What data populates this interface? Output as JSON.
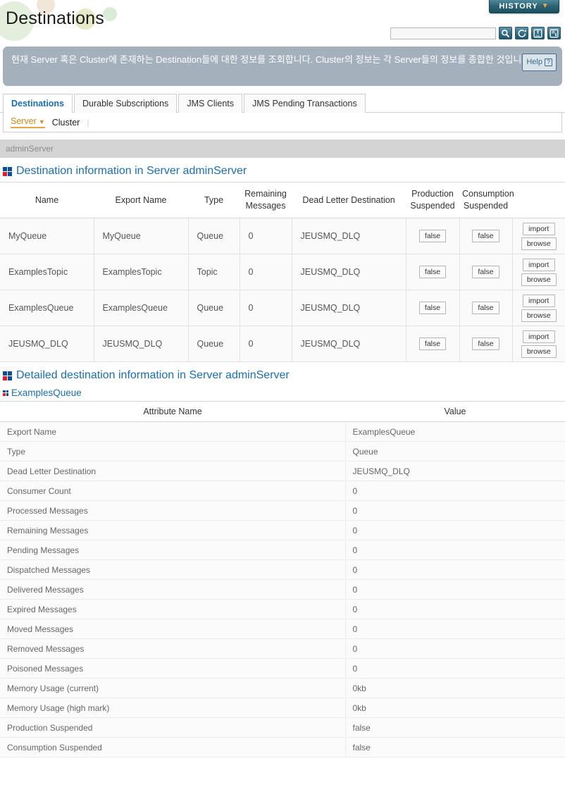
{
  "header": {
    "title": "Destinations",
    "history_label": "HISTORY",
    "history_caret": "▼",
    "search_value": "",
    "search_placeholder": "",
    "icons": [
      "search-icon",
      "refresh-icon",
      "xml-export-icon",
      "save-report-icon"
    ]
  },
  "description": {
    "text": "현재 Server 혹은 Cluster에 존재하는 Destination들에 대한 정보를 조회합니다. Cluster의 정보는 각 Server들의 정보를 종합한 것입니다.",
    "help_label": "Help",
    "help_mark": "?"
  },
  "tabs": [
    {
      "label": "Destinations",
      "active": true
    },
    {
      "label": "Durable Subscriptions",
      "active": false
    },
    {
      "label": "JMS Clients",
      "active": false
    },
    {
      "label": "JMS Pending Transactions",
      "active": false
    }
  ],
  "subtabs": {
    "server": "Server",
    "server_caret": "▼",
    "cluster": "Cluster",
    "separator": "|"
  },
  "server_bar": {
    "name": "adminServer"
  },
  "destination_section": {
    "title": "Destination information in Server adminServer",
    "columns": [
      "Name",
      "Export Name",
      "Type",
      "Remaining\nMessages",
      "Dead Letter Destination",
      "Production\nSuspended",
      "Consumption\nSuspended",
      ""
    ],
    "columns_display": {
      "name": "Name",
      "export_name": "Export Name",
      "type": "Type",
      "remaining_messages_l1": "Remaining",
      "remaining_messages_l2": "Messages",
      "dead_letter": "Dead Letter Destination",
      "production_l1": "Production",
      "production_l2": "Suspended",
      "consumption_l1": "Consumption",
      "consumption_l2": "Suspended"
    },
    "rows": [
      {
        "name": "MyQueue",
        "export_name": "MyQueue",
        "type": "Queue",
        "remaining_messages": "0",
        "dead_letter": "JEUSMQ_DLQ",
        "production_suspended": "false",
        "consumption_suspended": "false",
        "import_label": "import",
        "browse_label": "browse"
      },
      {
        "name": "ExamplesTopic",
        "export_name": "ExamplesTopic",
        "type": "Topic",
        "remaining_messages": "0",
        "dead_letter": "JEUSMQ_DLQ",
        "production_suspended": "false",
        "consumption_suspended": "false",
        "import_label": "import",
        "browse_label": "browse"
      },
      {
        "name": "ExamplesQueue",
        "export_name": "ExamplesQueue",
        "type": "Queue",
        "remaining_messages": "0",
        "dead_letter": "JEUSMQ_DLQ",
        "production_suspended": "false",
        "consumption_suspended": "false",
        "import_label": "import",
        "browse_label": "browse"
      },
      {
        "name": "JEUSMQ_DLQ",
        "export_name": "JEUSMQ_DLQ",
        "type": "Queue",
        "remaining_messages": "0",
        "dead_letter": "JEUSMQ_DLQ",
        "production_suspended": "false",
        "consumption_suspended": "false",
        "import_label": "import",
        "browse_label": "browse"
      }
    ]
  },
  "detail_section": {
    "title": "Detailed destination information in Server adminServer",
    "subtitle": "ExamplesQueue",
    "columns": {
      "attribute": "Attribute Name",
      "value": "Value"
    },
    "rows": [
      {
        "attribute": "Export Name",
        "value": "ExamplesQueue"
      },
      {
        "attribute": "Type",
        "value": "Queue"
      },
      {
        "attribute": "Dead Letter Destination",
        "value": "JEUSMQ_DLQ"
      },
      {
        "attribute": "Consumer Count",
        "value": "0"
      },
      {
        "attribute": "Processed Messages",
        "value": "0"
      },
      {
        "attribute": "Remaining Messages",
        "value": "0"
      },
      {
        "attribute": "Pending Messages",
        "value": "0"
      },
      {
        "attribute": "Dispatched Messages",
        "value": "0"
      },
      {
        "attribute": "Delivered Messages",
        "value": "0"
      },
      {
        "attribute": "Expired Messages",
        "value": "0"
      },
      {
        "attribute": "Moved Messages",
        "value": "0"
      },
      {
        "attribute": "Removed Messages",
        "value": "0"
      },
      {
        "attribute": "Poisoned Messages",
        "value": "0"
      },
      {
        "attribute": "Memory Usage (current)",
        "value": "0kb"
      },
      {
        "attribute": "Memory Usage (high mark)",
        "value": "0kb"
      },
      {
        "attribute": "Production Suspended",
        "value": "false"
      },
      {
        "attribute": "Consumption Suspended",
        "value": "false"
      }
    ]
  },
  "colors": {
    "accent_blue": "#1b6fb0",
    "banner_gray": "#a4b0bb",
    "history_teal": "#2d6576",
    "highlight_orange": "#d08a1a",
    "logo_blue": "#0b4f9b",
    "logo_red": "#e01f2b"
  }
}
